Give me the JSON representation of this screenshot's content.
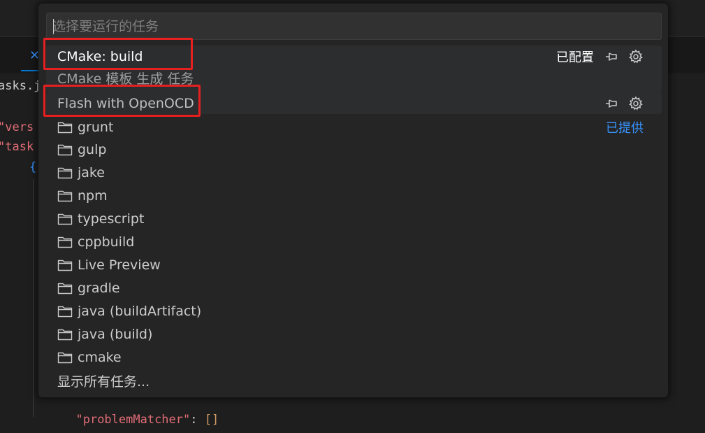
{
  "editor": {
    "file_tab": "asks.jso",
    "lines": {
      "version_key": "\"vers",
      "tasks_key": "\"task",
      "brace_open": "{",
      "problem_matcher_key": "\"problemMatcher\"",
      "colon": ":",
      "problem_matcher_value": "[]",
      "brace_close": "}",
      "comma": ","
    }
  },
  "quick_pick": {
    "placeholder": "选择要运行的任务",
    "configured_label": "已配置",
    "provided_label": "已提供",
    "configured_items": [
      {
        "label": "CMake: build",
        "detail": "CMake 模板 生成 任务"
      },
      {
        "label": "Flash with OpenOCD"
      }
    ],
    "provider_items": [
      "grunt",
      "gulp",
      "jake",
      "npm",
      "typescript",
      "cppbuild",
      "Live Preview",
      "gradle",
      "java (buildArtifact)",
      "java (build)",
      "cmake"
    ],
    "show_all": "显示所有任务...",
    "icons": {
      "pin": "pin-icon",
      "gear": "gear-icon",
      "folder": "folder-icon"
    },
    "colors": {
      "highlight": "#e62020",
      "link": "#3794ff"
    }
  }
}
